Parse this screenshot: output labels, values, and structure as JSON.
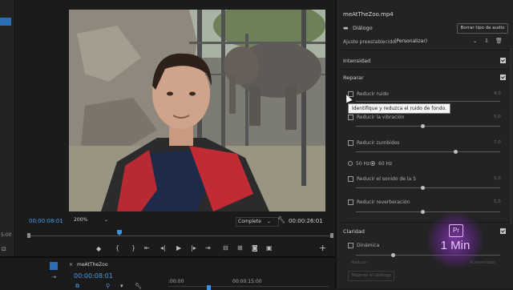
{
  "left_strip": {
    "bottom_label": "5:00"
  },
  "program_monitor": {
    "timecode_current": "00:00:08:01",
    "zoom_select": "200%",
    "quality_select": "Complete",
    "timecode_duration": "00:00:26:01",
    "transport_icons": [
      "marker-icon",
      "mark-in-icon",
      "mark-out-icon",
      "go-to-in-icon",
      "step-back-icon",
      "play-icon",
      "step-forward-icon",
      "go-to-out-icon",
      "insert-icon",
      "overwrite-icon",
      "export-frame-icon",
      "button-editor-icon",
      "add-icon"
    ]
  },
  "timeline": {
    "sequence_tab": "meAtTheZoo",
    "timecode": "00:00:08:01",
    "ruler_marks": [
      ":00:00",
      "00:00:15:00"
    ]
  },
  "essential_sound": {
    "header_clip": "meAtTheZoo.mp4",
    "type_label": "Diálogo",
    "clear_type_button": "Borrar tipo de audio",
    "preset_label": "Ajuste preestablecido:",
    "preset_value": "(Personalizar)",
    "sections": {
      "loudness": {
        "title": "Intensidad"
      },
      "repair": {
        "title": "Reparar",
        "items": [
          {
            "label": "Reducir ruido",
            "value": "4,0"
          },
          {
            "label": "Reducir la vibración",
            "value": "5,0"
          },
          {
            "label": "Reducir zumbidos",
            "value": "7,0"
          },
          {
            "label": "Reducir el sonido de la S",
            "value": "5,0"
          },
          {
            "label": "Reducir reverberación",
            "value": "5,0"
          }
        ],
        "hum_options": [
          "50 Hz",
          "60 Hz"
        ]
      },
      "clarity": {
        "title": "Claridad",
        "items": [
          {
            "label": "Dinámica"
          }
        ],
        "faint_labels": [
          "Reducir",
          "Aumentado"
        ],
        "faint_button": "Mejorar el diálogo"
      }
    }
  },
  "tooltip": {
    "text": "Identifique y reduzca el ruido de fondo."
  },
  "badge": {
    "logo_text": "Pr",
    "text": "1 Min"
  },
  "colors": {
    "accent_blue": "#3b8fe0",
    "timecode_blue": "#4a9be8",
    "badge_purple": "#b455f0"
  }
}
